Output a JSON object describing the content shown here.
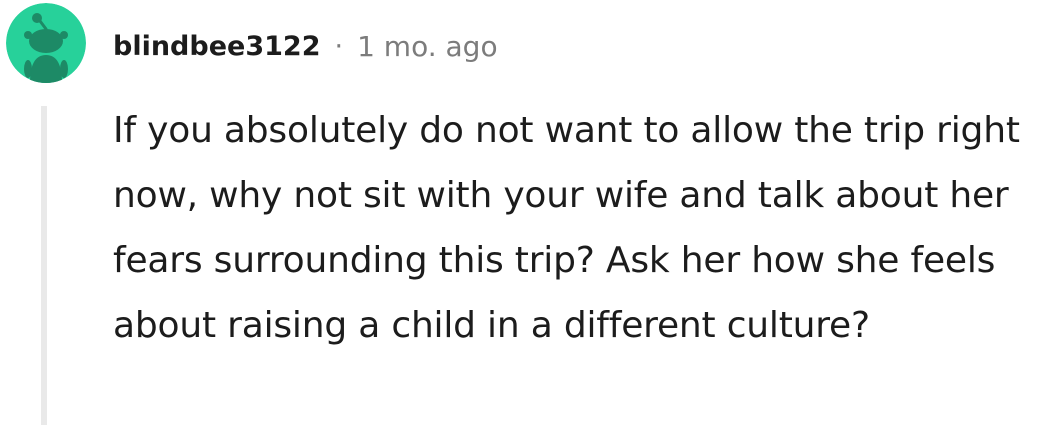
{
  "comment": {
    "author": "blindbee3122",
    "separator": "·",
    "timestamp": "1 mo. ago",
    "body": "If you absolutely do not want to allow the trip right now, why not sit with your wife and talk about her fears surrounding this trip? Ask her how she feels about raising a child in a different culture?",
    "avatar_icon": "snoo-avatar-icon",
    "colors": {
      "avatar_bg": "#27d19a",
      "avatar_figure": "#1d8a66",
      "thread_line": "#e9e9e9",
      "meta_text": "#7c7c7c",
      "body_text": "#1c1c1c"
    }
  }
}
